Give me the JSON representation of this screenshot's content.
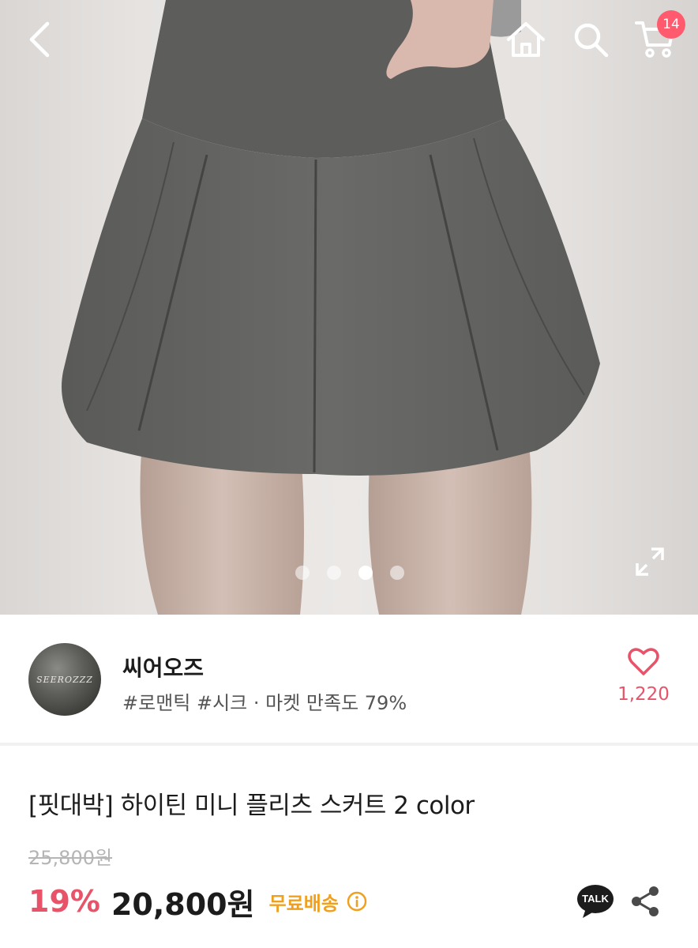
{
  "header": {
    "cart_count": "14"
  },
  "gallery": {
    "image_count": 4,
    "active_index": 2
  },
  "shop": {
    "name": "씨어오즈",
    "logo_text": "SEEROZZZ",
    "meta": "#로맨틱 #시크 · 마켓 만족도 79%",
    "like_count": "1,220"
  },
  "product": {
    "title": "[핏대박] 하이틴 미니 플리츠 스커트 2 color",
    "original_price": "25,800원",
    "discount": "19%",
    "sale_price": "20,800원",
    "shipping": "무료배송"
  },
  "actions": {
    "talk_label": "TALK"
  },
  "colors": {
    "accent": "#e8536a",
    "badge": "#ff5a6e",
    "shipping": "#f0a020"
  },
  "icons": [
    "back-icon",
    "home-icon",
    "search-icon",
    "cart-icon",
    "expand-icon",
    "heart-icon",
    "info-icon",
    "kakao-talk-icon",
    "share-icon"
  ]
}
